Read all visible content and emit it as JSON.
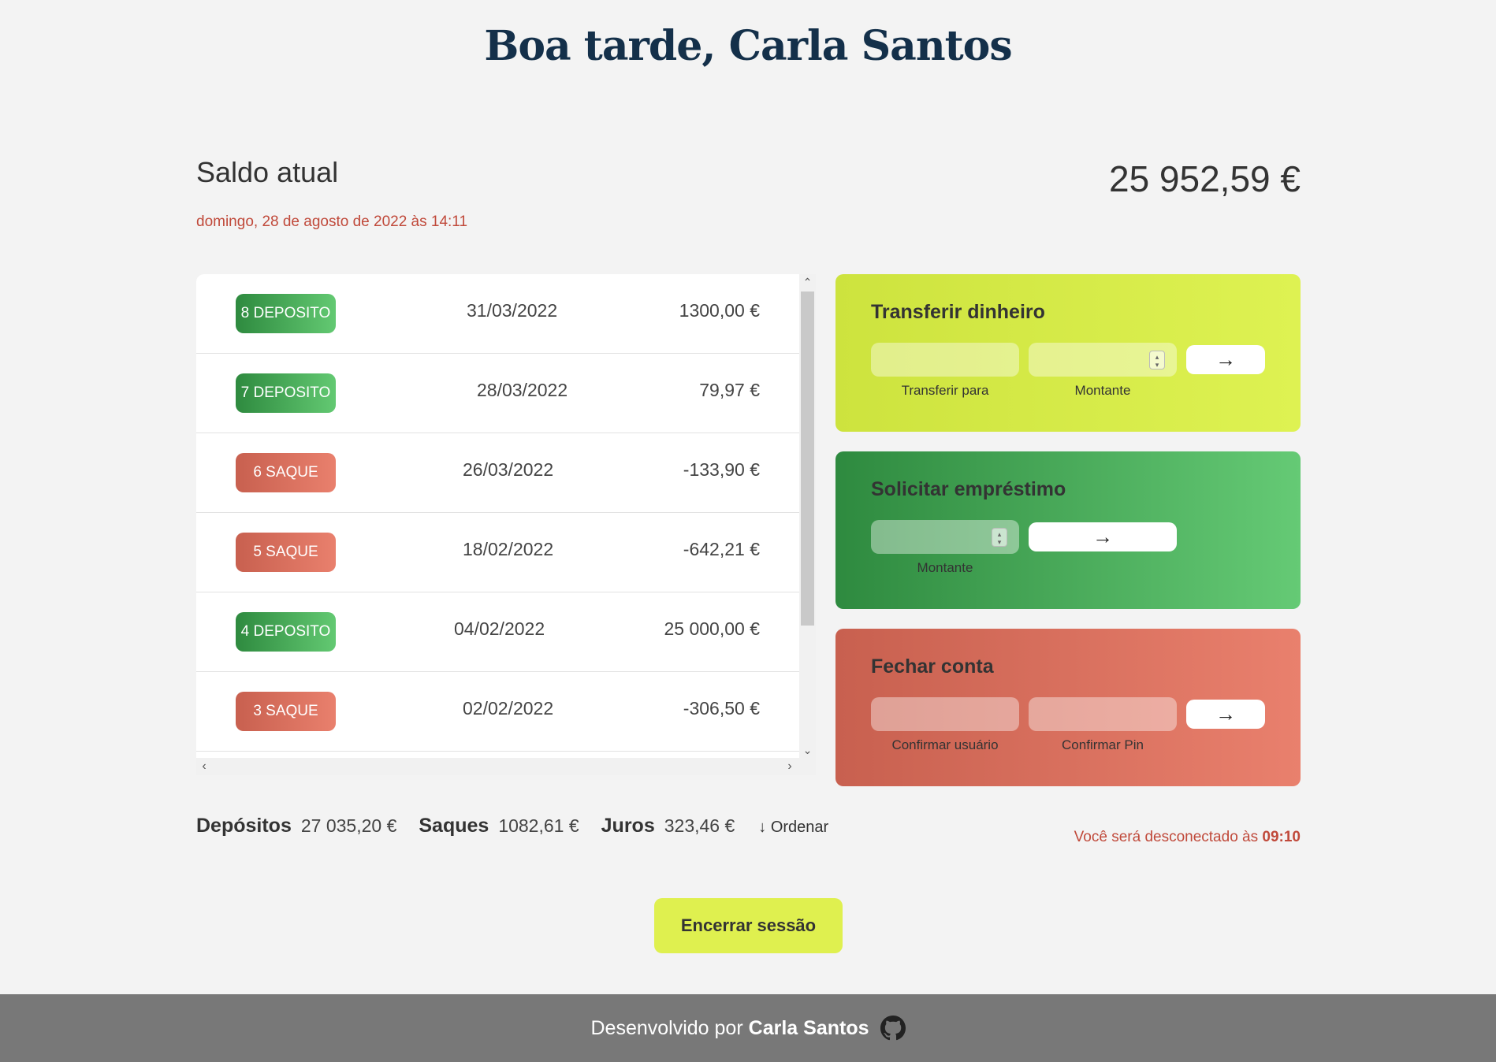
{
  "greeting": "Boa tarde, Carla Santos",
  "balance": {
    "label": "Saldo atual",
    "date": "domingo, 28 de agosto de 2022 às 14:11",
    "value": "25 952,59 €"
  },
  "movements": [
    {
      "type_label": "8 DEPOSITO",
      "kind": "deposit",
      "date": "31/03/2022",
      "value": "1300,00 €"
    },
    {
      "type_label": "7 DEPOSITO",
      "kind": "deposit",
      "date": "28/03/2022",
      "value": "79,97 €"
    },
    {
      "type_label": "6 SAQUE",
      "kind": "withdrawal",
      "date": "26/03/2022",
      "value": "-133,90 €"
    },
    {
      "type_label": "5 SAQUE",
      "kind": "withdrawal",
      "date": "18/02/2022",
      "value": "-642,21 €"
    },
    {
      "type_label": "4 DEPOSITO",
      "kind": "deposit",
      "date": "04/02/2022",
      "value": "25 000,00 €"
    },
    {
      "type_label": "3 SAQUE",
      "kind": "withdrawal",
      "date": "02/02/2022",
      "value": "-306,50 €"
    }
  ],
  "operations": {
    "transfer": {
      "title": "Transferir dinheiro",
      "to_label": "Transferir para",
      "amount_label": "Montante",
      "button": "→"
    },
    "loan": {
      "title": "Solicitar empréstimo",
      "amount_label": "Montante",
      "button": "→"
    },
    "close": {
      "title": "Fechar conta",
      "user_label": "Confirmar usuário",
      "pin_label": "Confirmar Pin",
      "button": "→"
    }
  },
  "summary": {
    "in_label": "Depósitos",
    "in_value": "27 035,20 €",
    "out_label": "Saques",
    "out_value": "1082,61 €",
    "interest_label": "Juros",
    "interest_value": "323,46 €",
    "sort_label": "↓ Ordenar"
  },
  "logout_timer": {
    "prefix": "Você será desconectado às",
    "time": "09:10"
  },
  "end_session_label": "Encerrar sessão",
  "footer": {
    "prefix": "Desenvolvido por",
    "author": "Carla Santos",
    "icon": "github-icon"
  },
  "colors": {
    "deposit": "#2e8a3f",
    "withdrawal": "#c8604f",
    "transfer": "#cde33e",
    "accent_text": "#c0493a",
    "title": "#14304a"
  }
}
